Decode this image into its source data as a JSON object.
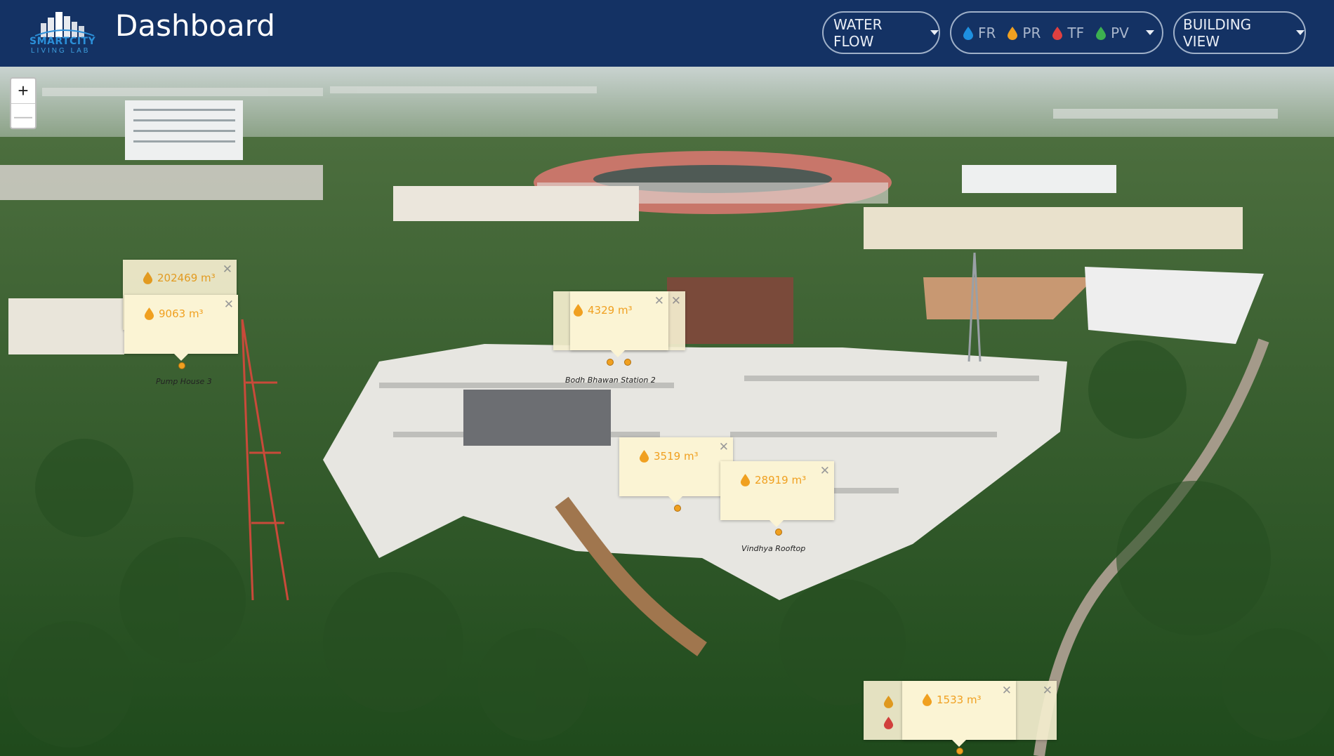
{
  "header": {
    "title": "Dashboard",
    "logo_text": "SMARTCITY",
    "logo_sub": "LIVING LAB",
    "water_flow_label": "WATER FLOW",
    "building_view_label": "BUILDING VIEW",
    "legend": [
      {
        "code": "FR",
        "color": "#1e90e0"
      },
      {
        "code": "PR",
        "color": "#f0a020"
      },
      {
        "code": "TF",
        "color": "#e04040"
      },
      {
        "code": "PV",
        "color": "#3cb050"
      }
    ]
  },
  "map": {
    "zoom_in": "+",
    "zoom_out": "—",
    "labels": {
      "pump_house": "Pump House 3",
      "bodh_bhawan": "Bodh Bhawan Station 2",
      "vindhya": "Vindhya Rooftop"
    },
    "popups": {
      "p1": {
        "value": "202469 m³"
      },
      "p2": {
        "value": "9063 m³"
      },
      "p3": {
        "value": "4329 m³"
      },
      "p4": {
        "value": "3519 m³"
      },
      "p5": {
        "value": "28919 m³"
      },
      "p6": {
        "value": "1533 m³"
      }
    },
    "close_symbol": "✕"
  }
}
